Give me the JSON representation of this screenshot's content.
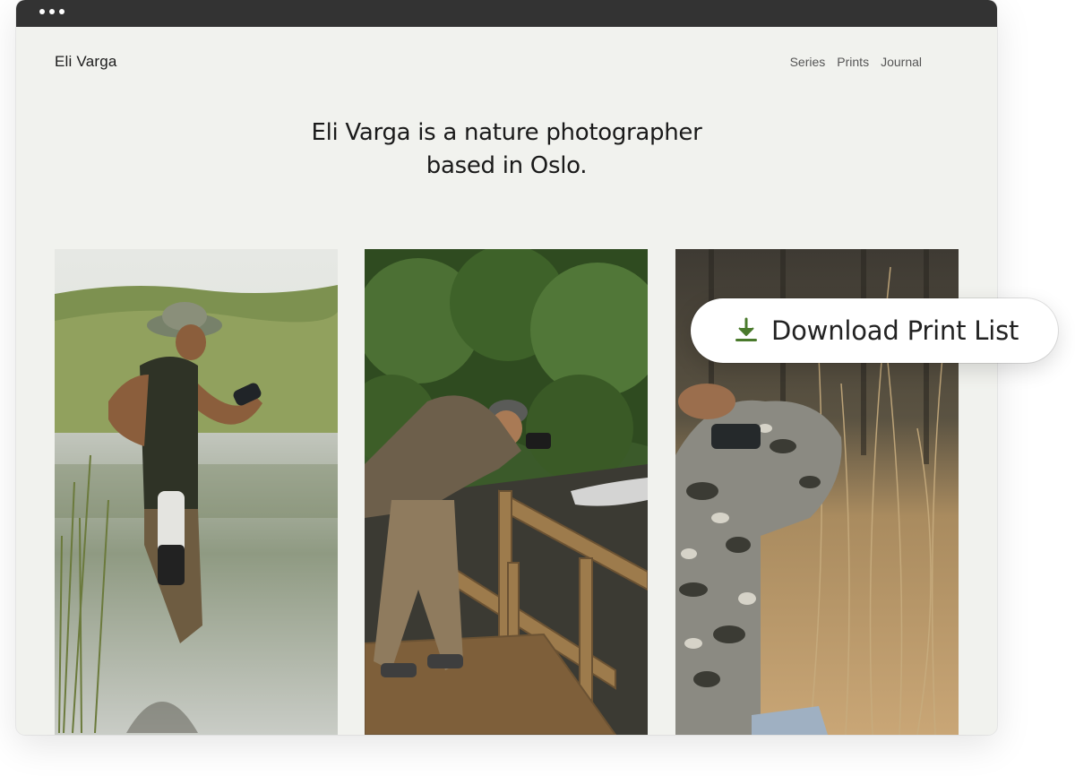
{
  "site": {
    "brand": "Eli Varga",
    "nav": [
      {
        "label": "Series"
      },
      {
        "label": "Prints"
      },
      {
        "label": "Journal"
      }
    ],
    "hero": {
      "line1": "Eli Varga is a nature photographer",
      "line2": "based in Oslo."
    }
  },
  "photos": [
    {
      "subject": "photographer-wading-lake"
    },
    {
      "subject": "photographer-on-wooden-bridge"
    },
    {
      "subject": "photographer-in-tall-grass"
    }
  ],
  "download": {
    "label": "Download Print List",
    "icon": "download-icon",
    "icon_color": "#4a7a2c"
  },
  "colors": {
    "page_bg": "#f1f2ee",
    "titlebar": "#333333",
    "text": "#1a1a1a"
  }
}
